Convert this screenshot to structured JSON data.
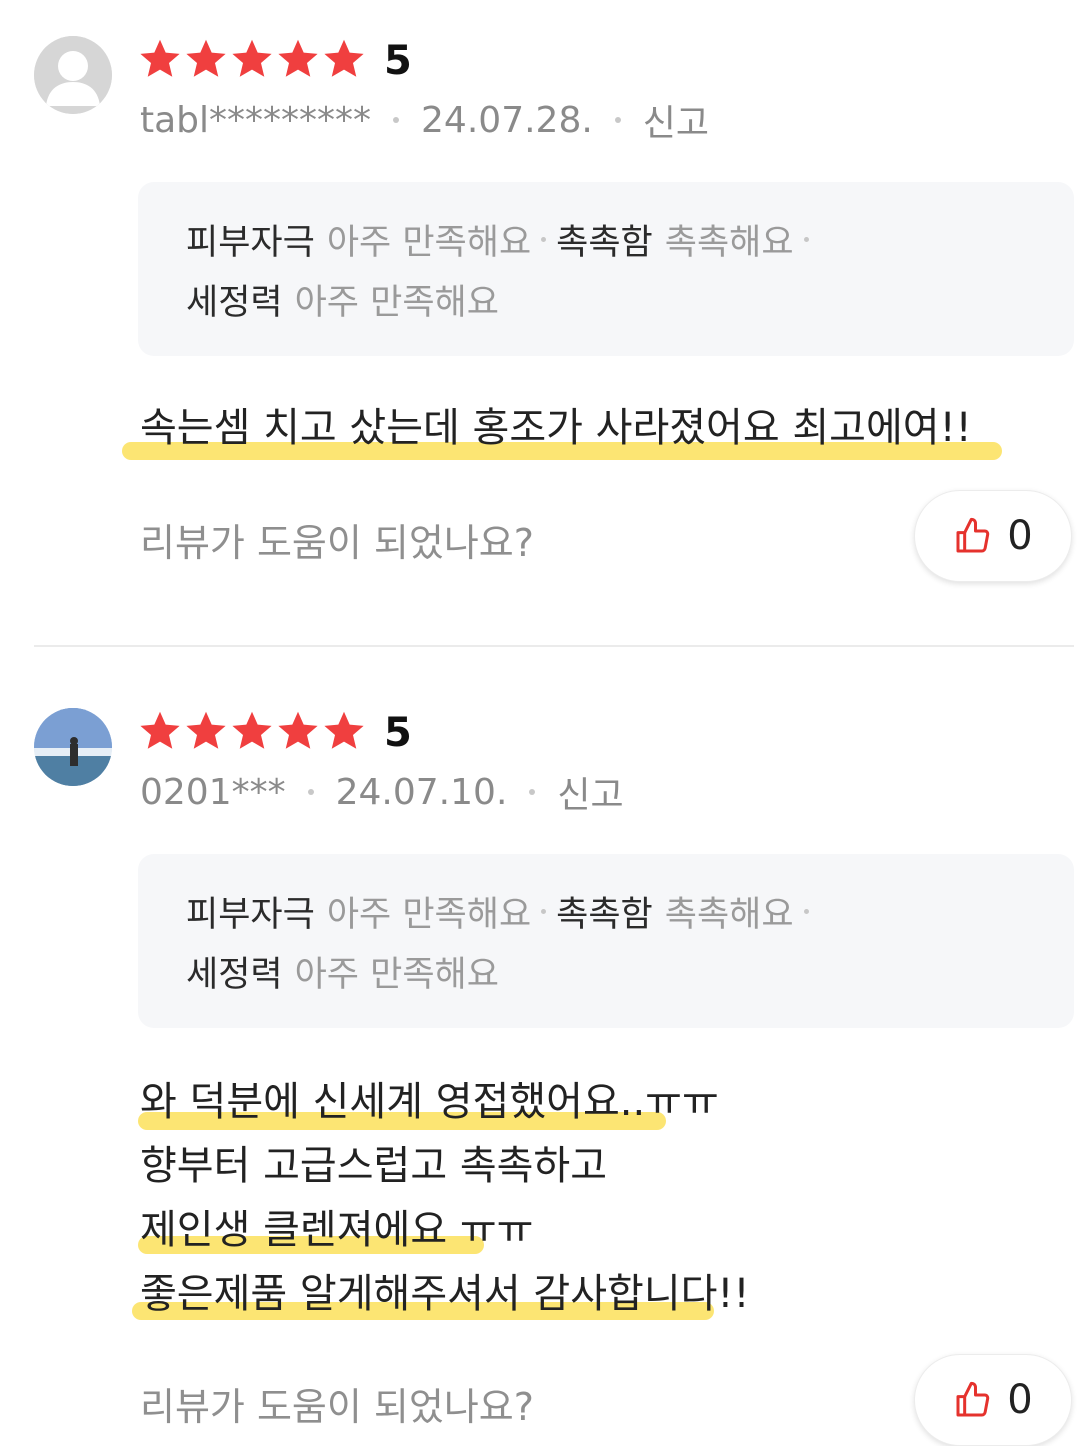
{
  "reviews": [
    {
      "score": "5",
      "user": "tabl*********",
      "date": "24.07.28.",
      "report": "신고",
      "evaluations": [
        {
          "key": "피부자극",
          "value": "아주 만족해요"
        },
        {
          "key": "촉촉함",
          "value": "촉촉해요"
        },
        {
          "key": "세정력",
          "value": "아주 만족해요"
        }
      ],
      "content": [
        "속는셈 치고 샀는데 홍조가 사라졌어요 최고에여!!"
      ],
      "helpful_prompt": "리뷰가 도움이 되었나요?",
      "likes": "0"
    },
    {
      "score": "5",
      "user": "0201***",
      "date": "24.07.10.",
      "report": "신고",
      "evaluations": [
        {
          "key": "피부자극",
          "value": "아주 만족해요"
        },
        {
          "key": "촉촉함",
          "value": "촉촉해요"
        },
        {
          "key": "세정력",
          "value": "아주 만족해요"
        }
      ],
      "content": [
        "와 덕분에 신세계 영접했어요..ㅠㅠ",
        "향부터 고급스럽고 촉촉하고",
        "제인생 클렌져에요 ㅠㅠ",
        "좋은제품 알게해주셔서 감사합니다!!"
      ],
      "helpful_prompt": "리뷰가 도움이 되었나요?",
      "likes": "0"
    }
  ],
  "colors": {
    "star": "#f03f3f",
    "like_icon": "#e5322d",
    "highlight": "#fbe15a"
  },
  "icons": {
    "rating": "star-icon",
    "like": "thumbs-up-icon",
    "avatar": "default-avatar-icon"
  }
}
